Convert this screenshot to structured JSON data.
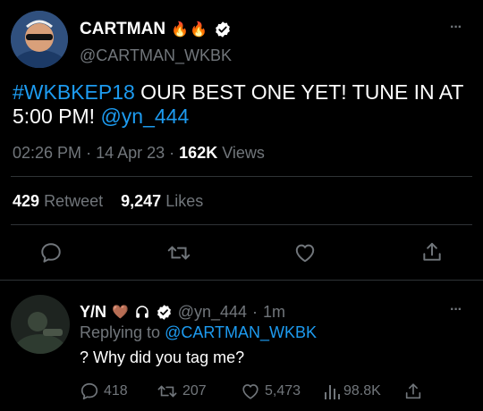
{
  "tweet": {
    "author_name": "CARTMAN",
    "author_emoji": "🔥🔥",
    "author_handle": "@CARTMAN_WKBK",
    "hashtag": "#WKBKEP18",
    "text_main": " OUR BEST ONE YET! TUNE IN AT",
    "text_line2": "5:00 PM! ",
    "mention": "@yn_444",
    "time": "02:26 PM",
    "sep": "·",
    "date": "14 Apr 23",
    "views_count": "162K",
    "views_label": "Views",
    "retweet_count": "429",
    "retweet_label": "Retweet",
    "likes_count": "9,247",
    "likes_label": "Likes",
    "more": "···"
  },
  "reply": {
    "author_name": "Y/N",
    "author_emoji": "🤎",
    "author_handle": "@yn_444",
    "time_ago": "1m",
    "replying_to_label": "Replying to",
    "replying_to_handle": "@CARTMAN_WKBK",
    "text": "? Why did you tag me?",
    "stats": {
      "replies": "418",
      "retweets": "207",
      "likes": "5,473",
      "views": "98.8K"
    },
    "more": "···"
  },
  "colors": {
    "background": "#000000",
    "text": "#e7e9ea",
    "muted": "#71767b",
    "accent": "#1d9bf0",
    "divider": "#2f3336"
  }
}
